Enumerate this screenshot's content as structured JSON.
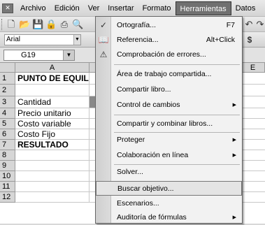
{
  "menubar": {
    "items": [
      {
        "label": "Archivo"
      },
      {
        "label": "Edición"
      },
      {
        "label": "Ver"
      },
      {
        "label": "Insertar"
      },
      {
        "label": "Formato"
      },
      {
        "label": "Herramientas"
      },
      {
        "label": "Datos"
      }
    ]
  },
  "formatbar": {
    "font": "Arial",
    "currency": "$"
  },
  "formulabar": {
    "namebox": "G19"
  },
  "columns": [
    "A",
    "E"
  ],
  "rows": [
    {
      "num": "1",
      "a": "PUNTO DE EQUIL"
    },
    {
      "num": "2",
      "a": ""
    },
    {
      "num": "3",
      "a": "Cantidad"
    },
    {
      "num": "4",
      "a": "Precio unitario"
    },
    {
      "num": "5",
      "a": "Costo variable"
    },
    {
      "num": "6",
      "a": "Costo Fijo"
    },
    {
      "num": "7",
      "a": "RESULTADO"
    },
    {
      "num": "8",
      "a": ""
    },
    {
      "num": "9",
      "a": ""
    },
    {
      "num": "10",
      "a": ""
    },
    {
      "num": "11",
      "a": ""
    },
    {
      "num": "12",
      "a": ""
    }
  ],
  "tools_menu": {
    "items": [
      {
        "label": "Ortografía...",
        "shortcut": "F7",
        "icon": "spellcheck-icon"
      },
      {
        "label": "Referencia...",
        "shortcut": "Alt+Click",
        "icon": "research-icon"
      },
      {
        "label": "Comprobación de errores...",
        "icon": "error-check-icon"
      },
      {
        "label": "Área de trabajo compartida..."
      },
      {
        "label": "Compartir libro..."
      },
      {
        "label": "Control de cambios",
        "arrow": "▶"
      },
      {
        "label": "Compartir y combinar libros..."
      },
      {
        "label": "Proteger",
        "arrow": "▶"
      },
      {
        "label": "Colaboración en línea",
        "arrow": "▶"
      },
      {
        "label": "Solver..."
      },
      {
        "label": "Buscar objetivo..."
      },
      {
        "label": "Escenarios..."
      },
      {
        "label": "Auditoría de fórmulas",
        "arrow": "▶"
      }
    ]
  }
}
